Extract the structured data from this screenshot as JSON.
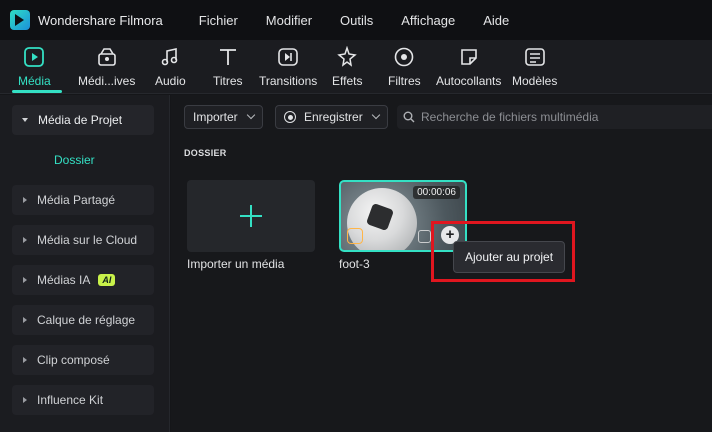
{
  "app": {
    "title": "Wondershare Filmora",
    "menu": [
      "Fichier",
      "Modifier",
      "Outils",
      "Affichage",
      "Aide"
    ]
  },
  "toolbar": {
    "tabs": [
      {
        "label": "Média",
        "icon": "media-icon",
        "active": true
      },
      {
        "label": "Médi...ives",
        "icon": "stock-media-icon",
        "active": false
      },
      {
        "label": "Audio",
        "icon": "audio-icon",
        "active": false
      },
      {
        "label": "Titres",
        "icon": "titles-icon",
        "active": false
      },
      {
        "label": "Transitions",
        "icon": "transitions-icon",
        "active": false
      },
      {
        "label": "Effets",
        "icon": "effects-icon",
        "active": false
      },
      {
        "label": "Filtres",
        "icon": "filters-icon",
        "active": false
      },
      {
        "label": "Autocollants",
        "icon": "stickers-icon",
        "active": false
      },
      {
        "label": "Modèles",
        "icon": "templates-icon",
        "active": false
      }
    ],
    "accent_color": "#34e0c4"
  },
  "sidebar": {
    "project_media": "Média de Projet",
    "folder": "Dossier",
    "items": [
      {
        "label": "Média Partagé"
      },
      {
        "label": "Média sur le Cloud"
      },
      {
        "label": "Médias IA",
        "badge": "AI"
      },
      {
        "label": "Calque de réglage"
      },
      {
        "label": "Clip composé"
      },
      {
        "label": "Influence Kit"
      }
    ]
  },
  "main": {
    "import_button": "Importer",
    "record_button": "Enregistrer",
    "search_placeholder": "Recherche de fichiers multimédia",
    "section_label": "DOSSIER",
    "import_card_label": "Importer un média",
    "clip": {
      "name": "foot-3",
      "duration": "00:00:06"
    },
    "tooltip": "Ajouter au projet"
  },
  "colors": {
    "highlight_box": "#e0161f",
    "ai_badge": "#c9f24a"
  }
}
